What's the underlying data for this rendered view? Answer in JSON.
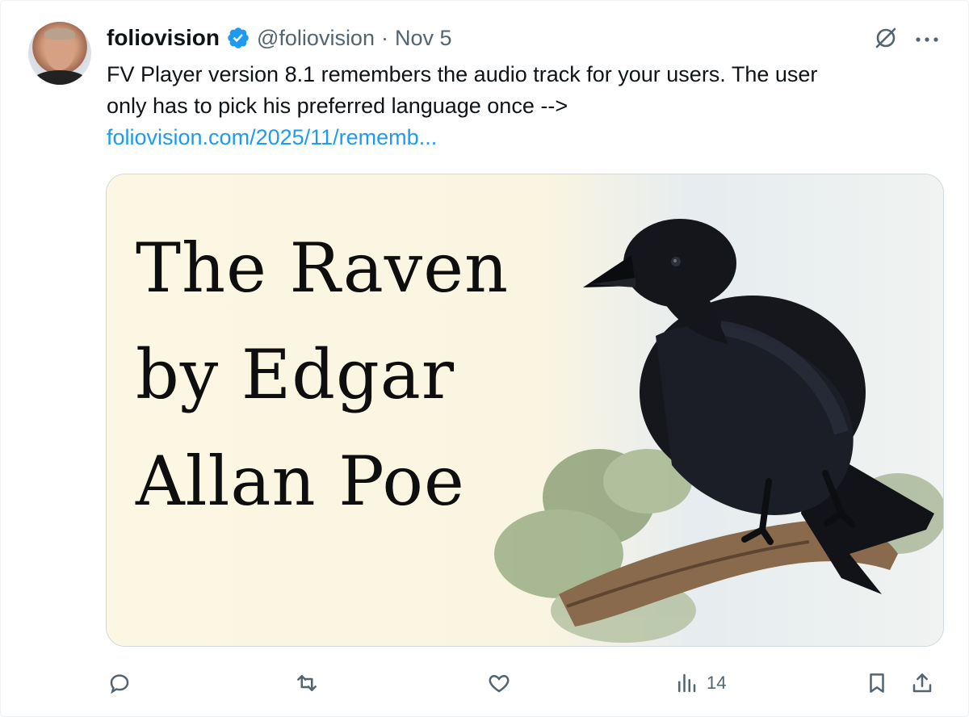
{
  "tweet": {
    "author_name": "foliovision",
    "handle": "@foliovision",
    "separator": "·",
    "date": "Nov 5",
    "text_line1": "FV Player version 8.1 remembers the audio track for your users. The user",
    "text_line2": "only has to pick his preferred language once -->",
    "link_text": "foliovision.com/2025/11/rememb..."
  },
  "media": {
    "title_line1": "The Raven",
    "title_line2": "by Edgar",
    "title_line3": "Allan Poe"
  },
  "actions": {
    "views_count": "14"
  },
  "icons": {
    "verified": "verified-badge-icon",
    "grok": "grok-icon",
    "more": "more-icon",
    "reply": "reply-icon",
    "retweet": "retweet-icon",
    "like": "like-icon",
    "views": "views-icon",
    "bookmark": "bookmark-icon",
    "share": "share-icon"
  },
  "colors": {
    "accent": "#1d9bf0",
    "text": "#0f1419",
    "secondary": "#536471",
    "border": "#cfd9de"
  }
}
